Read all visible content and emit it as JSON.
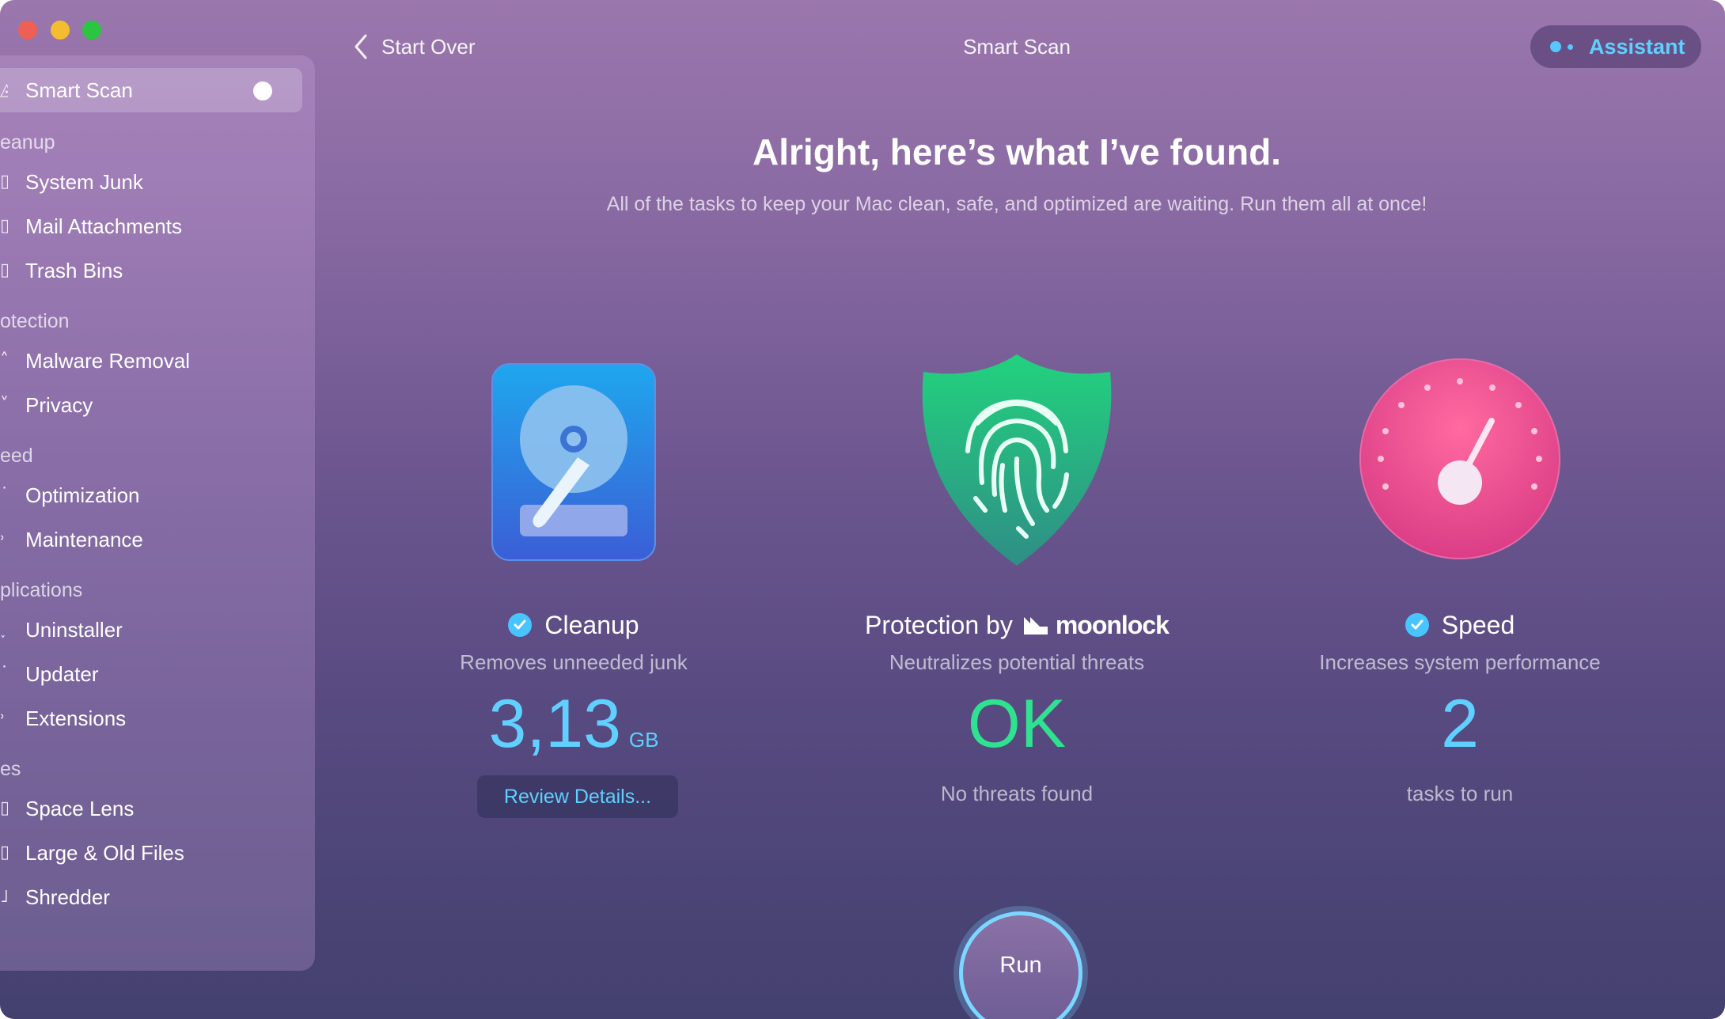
{
  "window": {
    "title": "Smart Scan",
    "back_label": "Start Over",
    "assistant_label": "Assistant"
  },
  "sidebar": {
    "active_item": "Smart Scan",
    "sections": [
      {
        "label": "eanup",
        "items": [
          "System Junk",
          "Mail Attachments",
          "Trash Bins"
        ]
      },
      {
        "label": "otection",
        "items": [
          "Malware Removal",
          "Privacy"
        ]
      },
      {
        "label": "eed",
        "items": [
          "Optimization",
          "Maintenance"
        ]
      },
      {
        "label": "plications",
        "items": [
          "Uninstaller",
          "Updater",
          "Extensions"
        ]
      },
      {
        "label": "es",
        "items": [
          "Space Lens",
          "Large & Old Files",
          "Shredder"
        ]
      }
    ]
  },
  "main": {
    "headline": "Alright, here’s what I’ve found.",
    "subline": "All of the tasks to keep your Mac clean, safe, and optimized are waiting. Run them all at once!",
    "cards": {
      "cleanup": {
        "title": "Cleanup",
        "description": "Removes unneeded junk",
        "value": "3,13",
        "unit": "GB",
        "button": "Review Details...",
        "value_color": "#5fd0ff"
      },
      "protection": {
        "title": "Protection by",
        "brand": "moonlock",
        "description": "Neutralizes potential threats",
        "value": "OK",
        "note": "No threats found",
        "value_color": "#2ee28f"
      },
      "speed": {
        "title": "Speed",
        "description": "Increases system performance",
        "value": "2",
        "note": "tasks to run",
        "value_color": "#5fd0ff"
      }
    },
    "run_label": "Run"
  },
  "colors": {
    "accent": "#5fd0ff",
    "ok": "#2ee28f",
    "traffic_red": "#ee5f56",
    "traffic_yellow": "#f4bd2f",
    "traffic_green": "#2cc541"
  }
}
